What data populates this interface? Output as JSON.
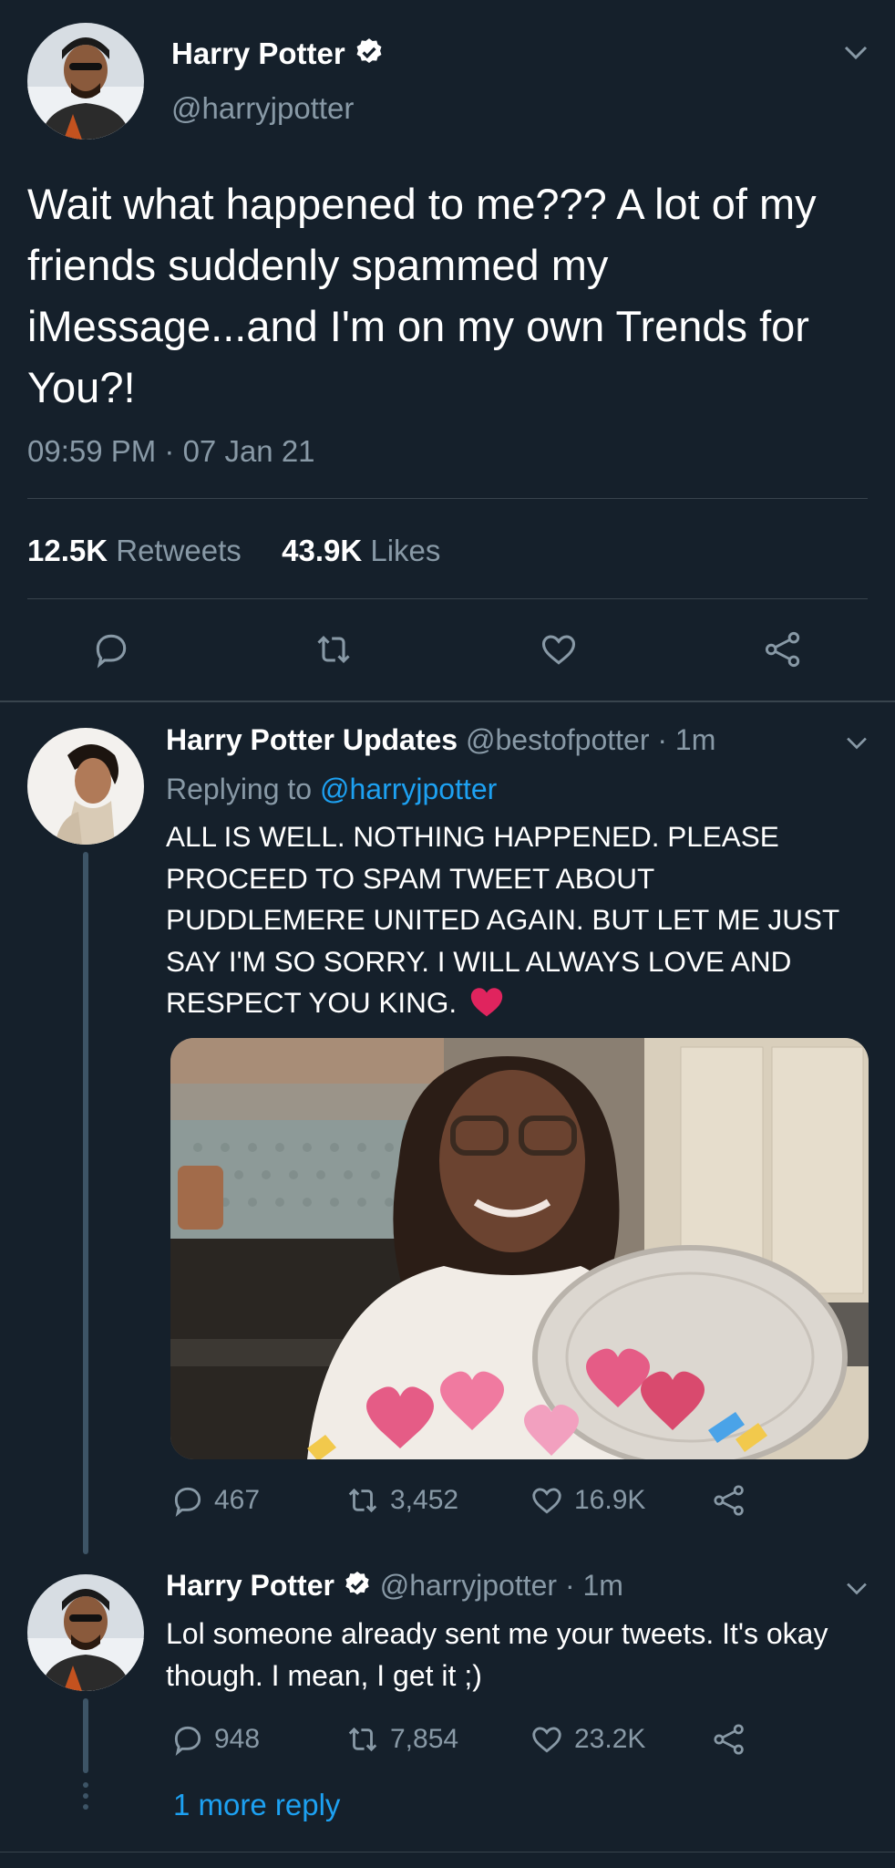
{
  "main_tweet": {
    "name": "Harry Potter",
    "handle": "@harryjpotter",
    "text": "Wait what happened to me??? A lot of my friends suddenly spammed my iMessage...and I'm on my own Trends for You?!",
    "timestamp": "09:59 PM · 07 Jan 21",
    "retweets_count": "12.5K",
    "retweets_label": "Retweets",
    "likes_count": "43.9K",
    "likes_label": "Likes"
  },
  "reply1": {
    "name": "Harry Potter Updates",
    "handle_time": "@bestofpotter · 1m",
    "replying_prefix": "Replying to",
    "replying_handle": "@harryjpotter",
    "text": "ALL IS WELL. NOTHING HAPPENED. PLEASE PROCEED TO SPAM TWEET ABOUT PUDDLEMERE UNITED AGAIN. BUT LET ME JUST SAY I'M SO SORRY. I WILL ALWAYS LOVE AND RESPECT YOU KING.",
    "reply_count": "467",
    "retweet_count": "3,452",
    "like_count": "16.9K"
  },
  "reply2": {
    "name": "Harry Potter",
    "handle_time": "@harryjpotter · 1m",
    "text": "Lol someone already sent me your tweets. It's okay though. I mean, I get it ;)",
    "reply_count": "948",
    "retweet_count": "7,854",
    "like_count": "23.2K"
  },
  "more_replies": "1 more reply",
  "colors": {
    "background": "#15202b",
    "accent": "#1da1f2",
    "muted": "#8899a6",
    "divider": "#38444d",
    "heart": "#e0245e"
  },
  "icons": [
    "verified-badge-icon",
    "chevron-down-icon",
    "reply-icon",
    "retweet-icon",
    "like-icon",
    "share-icon",
    "red-heart-emoji-icon"
  ]
}
